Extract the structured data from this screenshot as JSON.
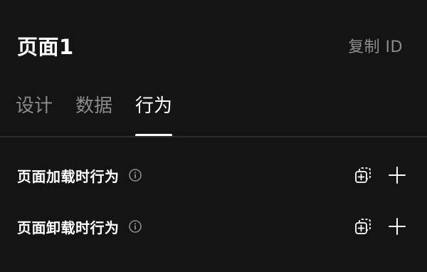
{
  "header": {
    "title": "页面1",
    "copy_id_label": "复制 ID"
  },
  "tabs": [
    {
      "label": "设计",
      "active": false
    },
    {
      "label": "数据",
      "active": false
    },
    {
      "label": "行为",
      "active": true
    }
  ],
  "behaviors": [
    {
      "label": "页面加载时行为",
      "icons": [
        "info-icon",
        "select-add-icon",
        "plus-icon"
      ]
    },
    {
      "label": "页面卸载时行为",
      "icons": [
        "info-icon",
        "select-add-icon",
        "plus-icon"
      ]
    }
  ],
  "colors": {
    "background": "#141414",
    "text_primary": "#ffffff",
    "text_secondary": "#8c8c8c",
    "divider": "#2e2e2e"
  }
}
